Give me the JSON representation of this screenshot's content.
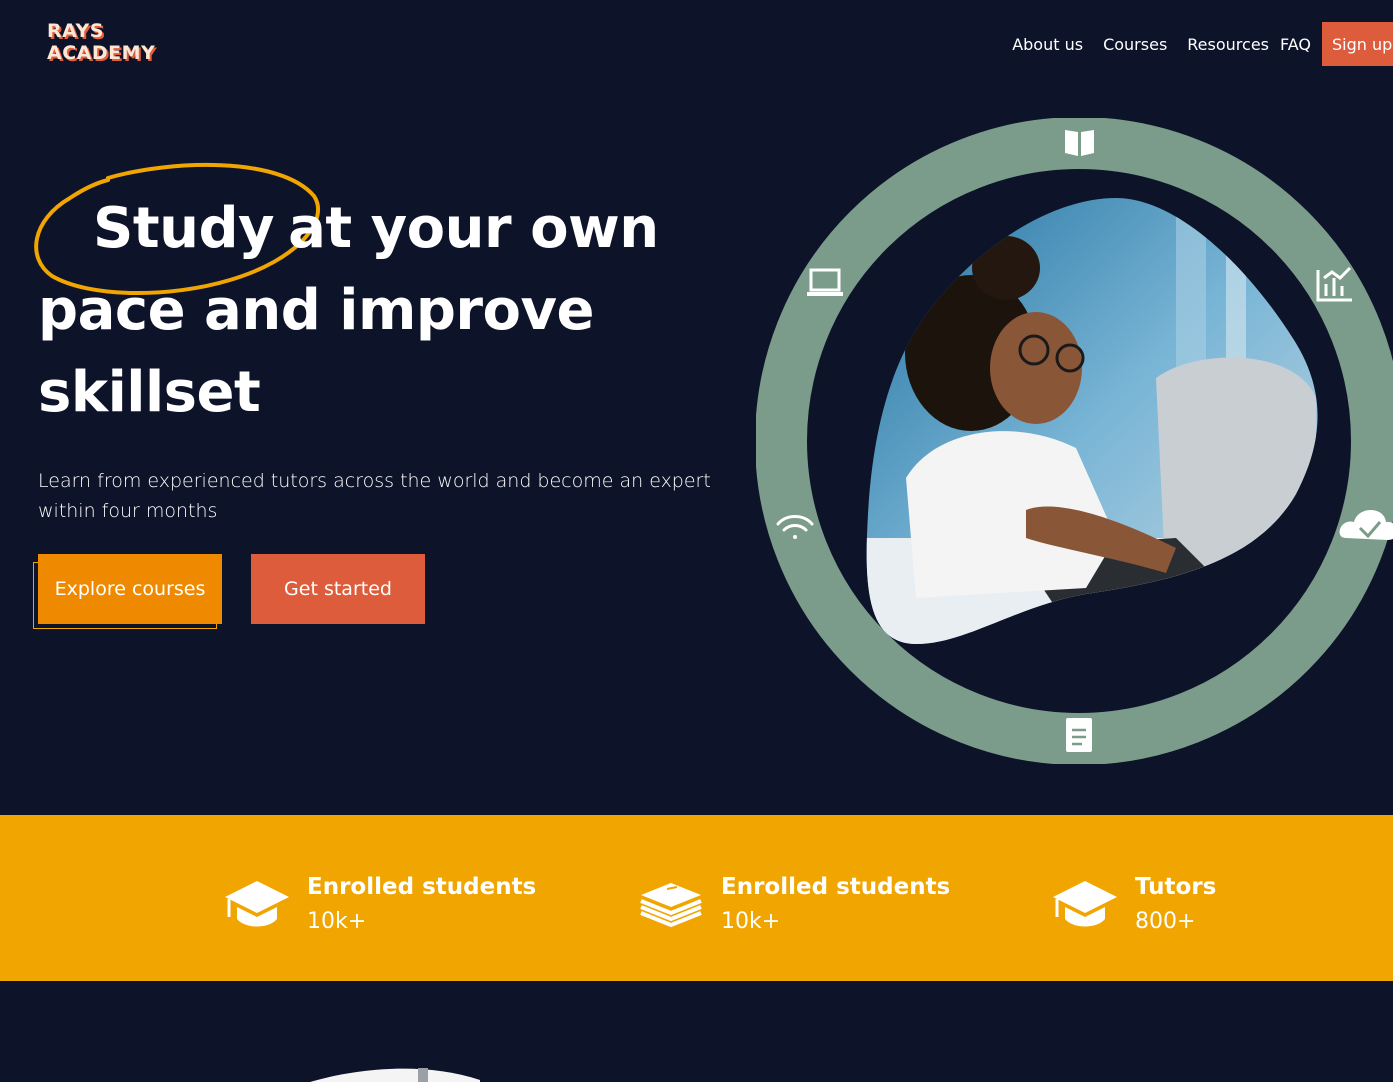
{
  "header": {
    "logo_line1": "RAYS",
    "logo_line2": "ACADEMY",
    "nav": [
      "About us",
      "Courses",
      "Resources",
      "FAQ"
    ],
    "signup": "Sign up"
  },
  "hero": {
    "title_highlight": "Study",
    "title_rest": "at your own pace and improve skillset",
    "subtitle": "Learn from experienced tutors across the world and become an expert within four months",
    "explore_button": "Explore courses",
    "start_button": "Get started"
  },
  "ring_icons": [
    "book-icon",
    "chart-icon",
    "cloud-check-icon",
    "notepad-icon",
    "wifi-icon",
    "laptop-icon"
  ],
  "stats": [
    {
      "icon": "graduation-cap-icon",
      "label": "Enrolled students",
      "value": "10k+"
    },
    {
      "icon": "books-icon",
      "label": "Enrolled students",
      "value": "10k+"
    },
    {
      "icon": "graduation-cap-icon",
      "label": "Tutors",
      "value": "800+"
    }
  ],
  "colors": {
    "background": "#0d1329",
    "accent_orange": "#ef8a00",
    "accent_red": "#dd5c3b",
    "band_yellow": "#f0a500",
    "ring_green": "#7b9c8a"
  }
}
